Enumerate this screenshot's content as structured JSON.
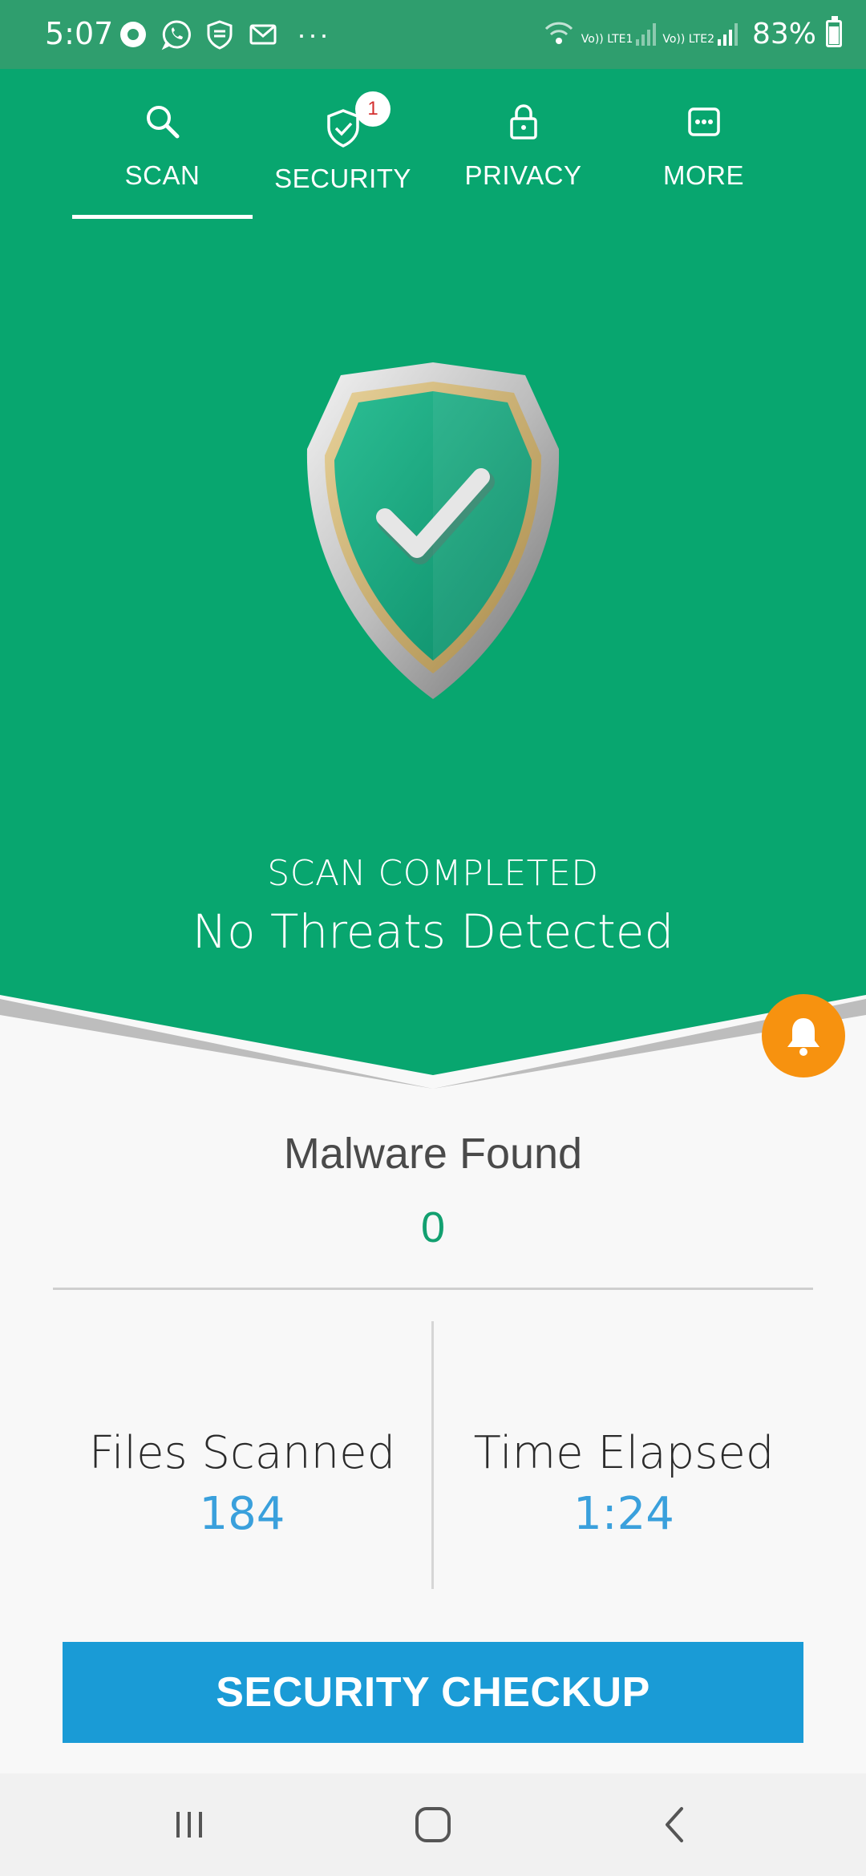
{
  "status_bar": {
    "time": "5:07",
    "more": "···",
    "sim1": "Vo)) LTE1",
    "sim2": "Vo)) LTE2",
    "battery": "83%"
  },
  "tabs": [
    {
      "label": "SCAN",
      "icon": "search-icon",
      "active": true
    },
    {
      "label": "SECURITY",
      "icon": "shield-check-icon",
      "badge": "1"
    },
    {
      "label": "PRIVACY",
      "icon": "lock-icon"
    },
    {
      "label": "MORE",
      "icon": "more-icon"
    }
  ],
  "scan": {
    "status": "SCAN COMPLETED",
    "result": "No Threats Detected"
  },
  "stats": {
    "malware_label": "Malware Found",
    "malware_value": "0",
    "files_label": "Files Scanned",
    "files_value": "184",
    "time_label": "Time Elapsed",
    "time_value": "1:24"
  },
  "cta": {
    "label": "SECURITY CHECKUP"
  },
  "colors": {
    "header_green": "#08a66f",
    "accent_blue": "#1a9bd6",
    "bell_orange": "#f7920f"
  }
}
